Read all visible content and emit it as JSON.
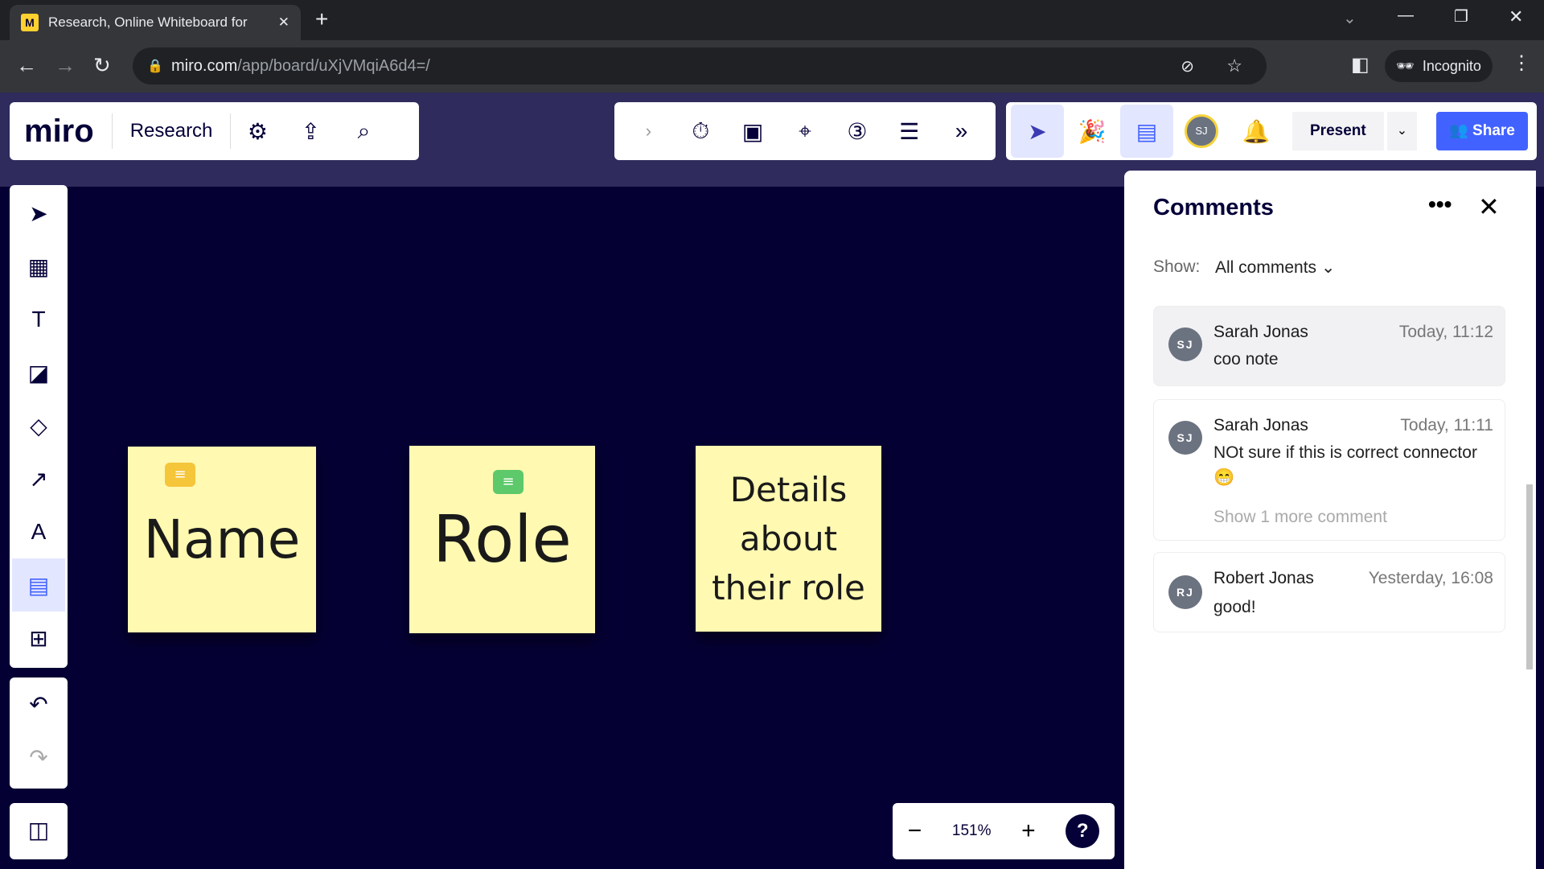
{
  "browser": {
    "tab_title": "Research, Online Whiteboard for",
    "url_host": "miro.com",
    "url_path": "/app/board/uXjVMqiA6d4=/",
    "profile": "Incognito"
  },
  "app": {
    "logo": "miro",
    "board_name": "Research",
    "present_label": "Present",
    "share_label": "Share",
    "avatar_initials": "SJ",
    "accent": "#4262ff"
  },
  "notes": [
    {
      "text": "Name"
    },
    {
      "text": "Role"
    },
    {
      "text": "Details about their role"
    }
  ],
  "zoom": {
    "level": "151%",
    "help": "?"
  },
  "comments": {
    "title": "Comments",
    "show_label": "Show:",
    "filter": "All comments",
    "items": [
      {
        "initials": "SJ",
        "author": "Sarah Jonas",
        "time": "Today, 11:12",
        "text": "coo note"
      },
      {
        "initials": "SJ",
        "author": "Sarah Jonas",
        "time": "Today, 11:11",
        "text": "NOt sure if this is correct connector 😁",
        "more": "Show 1 more comment"
      },
      {
        "initials": "RJ",
        "author": "Robert Jonas",
        "time": "Yesterday, 16:08",
        "text": "good!"
      }
    ]
  }
}
